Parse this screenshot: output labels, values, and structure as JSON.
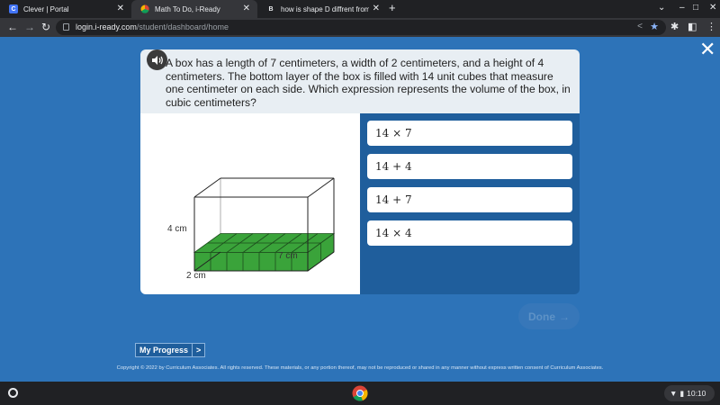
{
  "browser": {
    "tabs": [
      {
        "title": "Clever | Portal",
        "icon": "clever-icon",
        "active": false
      },
      {
        "title": "Math To Do, i-Ready",
        "icon": "iready-icon",
        "active": true
      },
      {
        "title": "how is shape D diffrent from sha",
        "icon": "brainly-icon",
        "active": false
      }
    ],
    "url_host": "login.i-ready.com",
    "url_path": "/student/dashboard/home"
  },
  "question": {
    "text": "A box has a length of 7 centimeters, a width of 2 centimeters, and a height of 4 centimeters. The bottom layer of the box is filled with 14 unit cubes that measure one centimeter on each side. Which expression represents the volume of the box, in cubic centimeters?"
  },
  "figure": {
    "height_label": "4 cm",
    "length_label": "7 cm",
    "width_label": "2 cm",
    "cube_color": "#3aa33a"
  },
  "answers": [
    "14 × 7",
    "14 + 4",
    "14 + 7",
    "14 × 4"
  ],
  "done_label": "Done",
  "my_progress_label": "My Progress",
  "my_progress_arrow": ">",
  "copyright": "Copyright © 2022 by Curriculum Associates. All rights reserved. These materials, or any portion thereof, may not be reproduced or shared in any manner without express written consent of Curriculum Associates.",
  "shelf": {
    "time": "10:10"
  }
}
